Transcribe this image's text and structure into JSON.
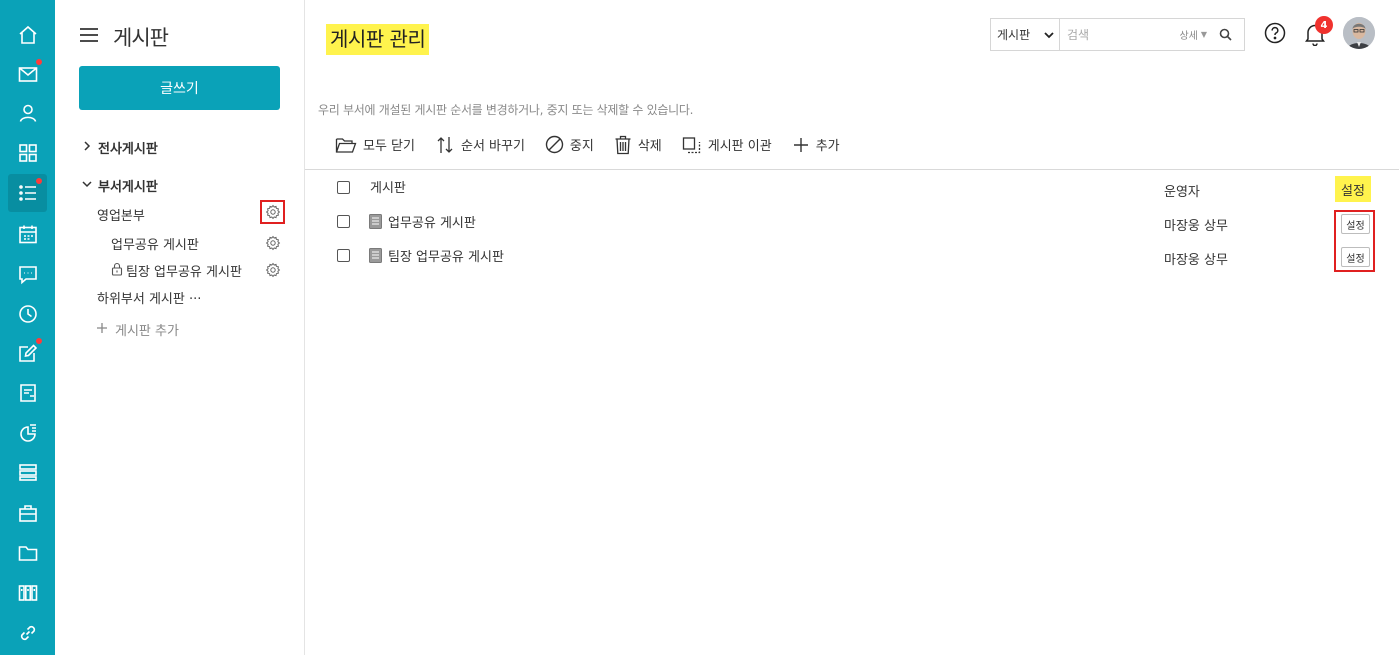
{
  "rail": {
    "icons": [
      "home-icon",
      "mail-icon",
      "contacts-icon",
      "apps-icon",
      "board-icon",
      "calendar-icon",
      "messenger-icon",
      "clock-icon",
      "approval-icon",
      "report-icon",
      "survey-icon",
      "docs-icon",
      "asset-icon",
      "folder-icon",
      "library-icon",
      "link-icon"
    ],
    "active": "board-icon",
    "notify": [
      "mail-icon",
      "board-icon",
      "approval-icon"
    ],
    "color": "#0aa2b8"
  },
  "sidebar": {
    "title": "게시판",
    "write_label": "글쓰기",
    "company_board": "전사게시판",
    "dept_board": "부서게시판",
    "dept_name": "영업본부",
    "items": [
      {
        "label": "업무공유 게시판",
        "locked": false
      },
      {
        "label": "팀장 업무공유 게시판",
        "locked": true
      }
    ],
    "sub_dept": "하위부서 게시판 ···",
    "add_board": "게시판 추가"
  },
  "header": {
    "page_title": "게시판 관리",
    "search_scope": "게시판",
    "search_placeholder": "검색",
    "search_detail": "상세",
    "notification_count": "4"
  },
  "description": "우리 부서에 개설된 게시판 순서를 변경하거나, 중지 또는 삭제할 수 있습니다.",
  "toolbar": {
    "collapse_all": "모두 닫기",
    "reorder": "순서 바꾸기",
    "stop": "중지",
    "delete": "삭제",
    "transfer": "게시판 이관",
    "add": "추가"
  },
  "table": {
    "headers": {
      "board": "게시판",
      "operator": "운영자",
      "settings": "설정"
    },
    "rows": [
      {
        "board": "업무공유 게시판",
        "operator": "마장웅 상무",
        "settings": "설정"
      },
      {
        "board": "팀장 업무공유 게시판",
        "operator": "마장웅 상무",
        "settings": "설정"
      }
    ]
  },
  "colors": {
    "accent": "#0aa2b8",
    "highlight": "#fff34d",
    "annotation": "#e02020",
    "badge": "#f0322e"
  }
}
